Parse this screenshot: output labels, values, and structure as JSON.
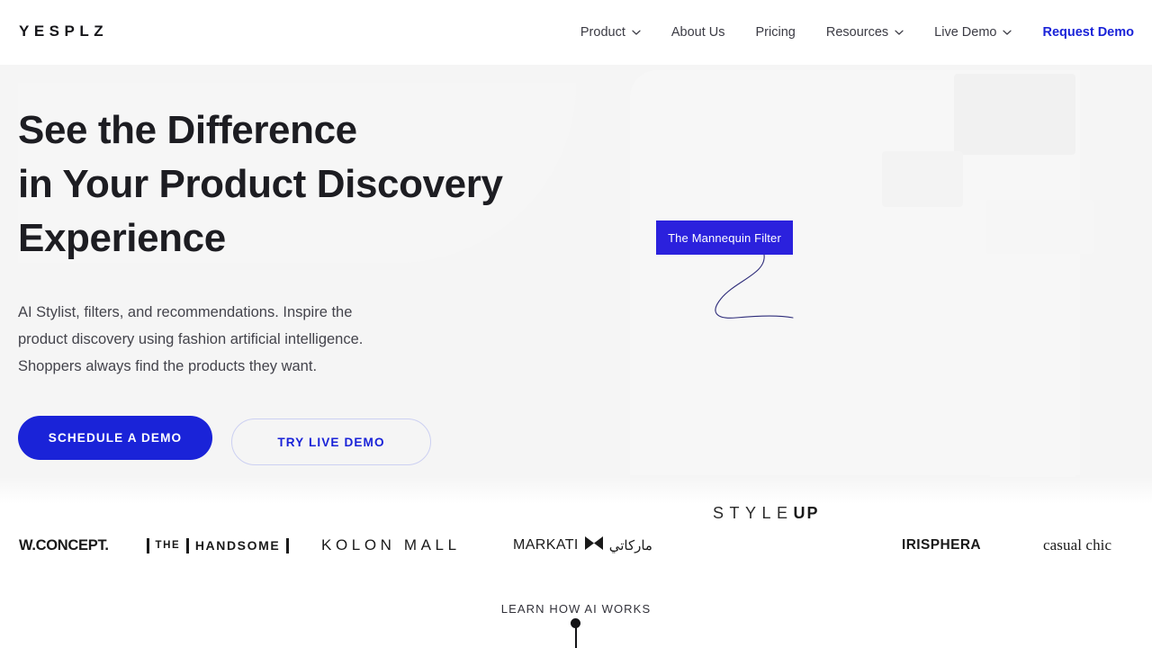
{
  "header": {
    "logo": "YESPLZ",
    "nav": [
      {
        "label": "Product",
        "icon": "chevron-down-icon",
        "has_caret": true,
        "accent": false
      },
      {
        "label": "About Us",
        "icon": "",
        "has_caret": false,
        "accent": false
      },
      {
        "label": "Pricing",
        "icon": "",
        "has_caret": false,
        "accent": false
      },
      {
        "label": "Resources",
        "icon": "chevron-down-icon",
        "has_caret": true,
        "accent": false
      },
      {
        "label": "Live Demo",
        "icon": "chevron-down-icon",
        "has_caret": true,
        "accent": false
      },
      {
        "label": "Request Demo",
        "icon": "",
        "has_caret": false,
        "accent": true
      }
    ]
  },
  "hero": {
    "headline_lines": [
      "See the Difference",
      "in Your Product Discovery",
      "Experience"
    ],
    "subtext_lines": [
      "AI Stylist, filters, and recommendations. Inspire the",
      "product discovery using fashion artificial intelligence.",
      "Shoppers always find the products they want."
    ],
    "primary_cta": "SCHEDULE A DEMO",
    "secondary_cta": "TRY LIVE DEMO",
    "badge_label": "The Mannequin Filter",
    "curve_icon": "mannequin-curve-line"
  },
  "brands": {
    "wconcept": "W.CONCEPT.",
    "handsome_the": "THE",
    "handsome_name": "HANDSOME",
    "kolon": "KOLON MALL",
    "markati_latin": "MARKATI",
    "markati_icon": "markati-hourglass-icon",
    "markati_arabic": "ماركاتي",
    "styleup_light": "STYLE",
    "styleup_bold": "UP",
    "irisphera": "IRISPHERA",
    "casual_chic": "casual chic"
  },
  "footer": {
    "learn_label": "LEARN HOW AI WORKS",
    "scroll_icon": "scroll-down-indicator"
  },
  "colors": {
    "accent_blue": "#1a23d8",
    "badge_blue": "#2b21dd",
    "hero_bg": "#f5f5f5",
    "header_bg": "#ffffff",
    "text_dark": "#1d1d22"
  }
}
